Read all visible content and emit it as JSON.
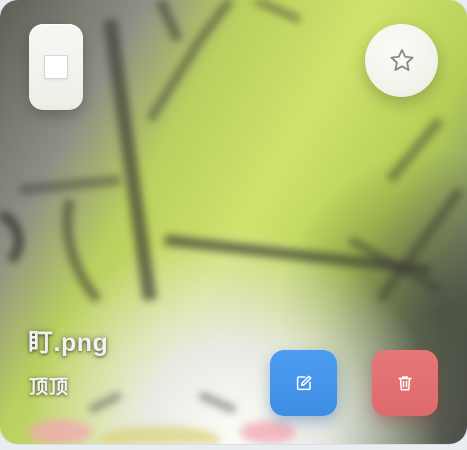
{
  "file": {
    "name": "盯.png",
    "description": "顶顶"
  },
  "icons": {
    "select": "checkbox-icon",
    "favorite": "star-icon",
    "edit": "edit-icon",
    "delete": "trash-icon"
  },
  "colors": {
    "edit_button": "#4597ec",
    "delete_button": "#e27172",
    "favorite_button": "#f3f4ee",
    "select_button": "#f2f3ee"
  }
}
